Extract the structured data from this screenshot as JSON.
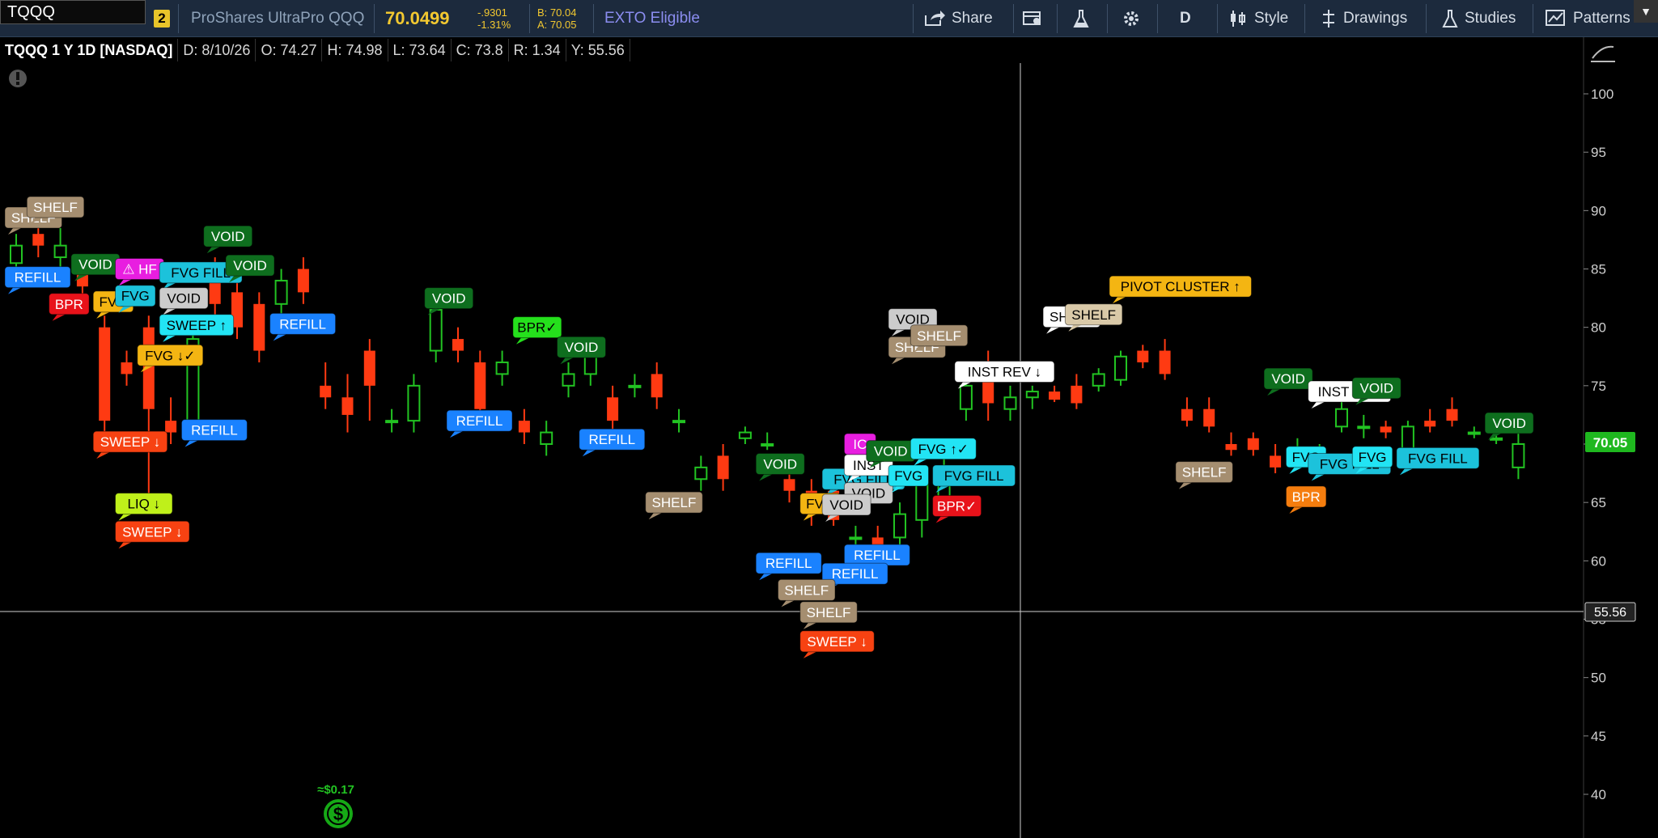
{
  "toolbar": {
    "symbol": "TQQQ",
    "link_number": "2",
    "description": "ProShares UltraPro QQQ",
    "last": "70.0499",
    "change": "-.9301",
    "change_pct": "-1.31%",
    "bid": "B: 70.04",
    "ask": "A: 70.05",
    "exto": "EXTO Eligible",
    "share_label": "Share",
    "aggregation": "D",
    "style_label": "Style",
    "drawings_label": "Drawings",
    "studies_label": "Studies",
    "patterns_label": "Patterns"
  },
  "legend": {
    "title": "TQQQ 1 Y 1D [NASDAQ]",
    "date": "D: 8/10/26",
    "open": "O: 74.27",
    "high": "H: 74.98",
    "low": "L: 73.64",
    "close": "C: 73.8",
    "range": "R: 1.34",
    "y": "Y: 55.56"
  },
  "dividend": {
    "label": "≈$0.17",
    "icon": "dividend-icon"
  },
  "colors": {
    "up": "#22c322",
    "down": "#ff3a12",
    "background": "#000000",
    "price_badge": "#1fb81f"
  },
  "chart_data": {
    "type": "candlestick",
    "y_axis": {
      "min": 40,
      "max": 100,
      "ticks": [
        100,
        95,
        90,
        85,
        80,
        75,
        70,
        65,
        60,
        55,
        50,
        45,
        40
      ]
    },
    "last_price_label": "70.05",
    "crosshair_price_label": "55.56",
    "candles": [
      {
        "open": 85.5,
        "close": 87.0,
        "high": 88.0,
        "low": 84.5
      },
      {
        "open": 88.0,
        "close": 87.0,
        "high": 89.0,
        "low": 86.0
      },
      {
        "open": 86.0,
        "close": 87.0,
        "high": 88.5,
        "low": 85.0
      },
      {
        "open": 85.5,
        "close": 83.5,
        "high": 86.0,
        "low": 82.0
      },
      {
        "open": 80.0,
        "close": 72.0,
        "high": 81.0,
        "low": 71.0
      },
      {
        "open": 77.0,
        "close": 76.0,
        "high": 78.0,
        "low": 75.0
      },
      {
        "open": 80.0,
        "close": 73.0,
        "high": 81.0,
        "low": 65.0
      },
      {
        "open": 72.0,
        "close": 71.0,
        "high": 74.0,
        "low": 70.0
      },
      {
        "open": 72.0,
        "close": 79.0,
        "high": 80.0,
        "low": 71.0
      },
      {
        "open": 84.5,
        "close": 82.0,
        "high": 86.0,
        "low": 81.0
      },
      {
        "open": 83.0,
        "close": 80.0,
        "high": 84.0,
        "low": 79.0
      },
      {
        "open": 82.0,
        "close": 78.0,
        "high": 83.0,
        "low": 77.0
      },
      {
        "open": 82.0,
        "close": 84.0,
        "high": 85.0,
        "low": 81.0
      },
      {
        "open": 85.0,
        "close": 83.0,
        "high": 86.0,
        "low": 82.0
      },
      {
        "open": 75.0,
        "close": 74.0,
        "high": 77.0,
        "low": 73.0
      },
      {
        "open": 74.0,
        "close": 72.5,
        "high": 76.0,
        "low": 71.0
      },
      {
        "open": 78.0,
        "close": 75.0,
        "high": 79.0,
        "low": 72.0
      },
      {
        "open": 72.0,
        "close": 72.0,
        "high": 73.0,
        "low": 71.0
      },
      {
        "open": 72.0,
        "close": 75.0,
        "high": 76.0,
        "low": 71.0
      },
      {
        "open": 78.0,
        "close": 81.5,
        "high": 82.0,
        "low": 77.0
      },
      {
        "open": 79.0,
        "close": 78.0,
        "high": 80.0,
        "low": 77.0
      },
      {
        "open": 77.0,
        "close": 73.0,
        "high": 78.0,
        "low": 72.0
      },
      {
        "open": 76.0,
        "close": 77.0,
        "high": 78.0,
        "low": 75.0
      },
      {
        "open": 72.0,
        "close": 71.0,
        "high": 73.0,
        "low": 70.0
      },
      {
        "open": 70.0,
        "close": 71.0,
        "high": 72.0,
        "low": 69.0
      },
      {
        "open": 75.0,
        "close": 76.0,
        "high": 77.0,
        "low": 74.0
      },
      {
        "open": 76.0,
        "close": 77.5,
        "high": 78.0,
        "low": 75.0
      },
      {
        "open": 74.0,
        "close": 72.0,
        "high": 75.0,
        "low": 71.0
      },
      {
        "open": 75.0,
        "close": 75.0,
        "high": 76.0,
        "low": 74.0
      },
      {
        "open": 76.0,
        "close": 74.0,
        "high": 77.0,
        "low": 73.0
      },
      {
        "open": 72.0,
        "close": 72.0,
        "high": 73.0,
        "low": 71.0
      },
      {
        "open": 67.0,
        "close": 68.0,
        "high": 69.0,
        "low": 66.0
      },
      {
        "open": 69.0,
        "close": 67.0,
        "high": 70.0,
        "low": 66.0
      },
      {
        "open": 70.5,
        "close": 71.0,
        "high": 71.5,
        "low": 70.0
      },
      {
        "open": 70.0,
        "close": 70.0,
        "high": 71.0,
        "low": 69.5
      },
      {
        "open": 67.0,
        "close": 66.0,
        "high": 68.0,
        "low": 65.0
      },
      {
        "open": 66.0,
        "close": 64.0,
        "high": 67.0,
        "low": 63.0
      },
      {
        "open": 66.0,
        "close": 63.5,
        "high": 67.0,
        "low": 63.0
      },
      {
        "open": 62.0,
        "close": 62.0,
        "high": 63.0,
        "low": 61.0
      },
      {
        "open": 62.0,
        "close": 61.0,
        "high": 63.0,
        "low": 60.0
      },
      {
        "open": 62.0,
        "close": 64.0,
        "high": 65.0,
        "low": 61.0
      },
      {
        "open": 63.5,
        "close": 67.0,
        "high": 68.0,
        "low": 62.0
      },
      {
        "open": 65.0,
        "close": 67.0,
        "high": 69.0,
        "low": 64.0
      },
      {
        "open": 73.0,
        "close": 75.0,
        "high": 76.0,
        "low": 72.0
      },
      {
        "open": 76.5,
        "close": 73.5,
        "high": 78.0,
        "low": 72.0
      },
      {
        "open": 73.0,
        "close": 74.0,
        "high": 75.0,
        "low": 72.0
      },
      {
        "open": 74.0,
        "close": 74.5,
        "high": 75.0,
        "low": 73.0
      },
      {
        "open": 74.5,
        "close": 73.8,
        "high": 75.0,
        "low": 73.6
      },
      {
        "open": 75.0,
        "close": 73.5,
        "high": 76.0,
        "low": 73.0
      },
      {
        "open": 75.0,
        "close": 76.0,
        "high": 76.5,
        "low": 74.5
      },
      {
        "open": 75.5,
        "close": 77.5,
        "high": 78.0,
        "low": 75.0
      },
      {
        "open": 78.0,
        "close": 77.0,
        "high": 78.5,
        "low": 76.5
      },
      {
        "open": 78.0,
        "close": 76.0,
        "high": 79.0,
        "low": 75.5
      },
      {
        "open": 73.0,
        "close": 72.0,
        "high": 74.0,
        "low": 71.5
      },
      {
        "open": 73.0,
        "close": 71.5,
        "high": 74.0,
        "low": 71.0
      },
      {
        "open": 70.0,
        "close": 69.5,
        "high": 71.0,
        "low": 69.0
      },
      {
        "open": 70.5,
        "close": 69.5,
        "high": 71.0,
        "low": 69.0
      },
      {
        "open": 69.0,
        "close": 68.0,
        "high": 70.0,
        "low": 67.5
      },
      {
        "open": 69.0,
        "close": 69.5,
        "high": 70.5,
        "low": 68.0
      },
      {
        "open": 68.5,
        "close": 69.5,
        "high": 70.0,
        "low": 68.0
      },
      {
        "open": 71.5,
        "close": 73.0,
        "high": 74.0,
        "low": 71.0
      },
      {
        "open": 71.5,
        "close": 71.5,
        "high": 72.5,
        "low": 70.5
      },
      {
        "open": 71.5,
        "close": 71.0,
        "high": 72.0,
        "low": 70.5
      },
      {
        "open": 69.5,
        "close": 71.5,
        "high": 72.0,
        "low": 69.0
      },
      {
        "open": 72.0,
        "close": 71.5,
        "high": 73.0,
        "low": 71.0
      },
      {
        "open": 73.0,
        "close": 72.0,
        "high": 74.0,
        "low": 71.5
      },
      {
        "open": 71.0,
        "close": 71.0,
        "high": 71.5,
        "low": 70.5
      },
      {
        "open": 70.5,
        "close": 70.5,
        "high": 71.0,
        "low": 70.0
      },
      {
        "open": 68.0,
        "close": 70.0,
        "high": 71.0,
        "low": 67.0
      }
    ],
    "annotations": [
      {
        "text": "SHELF",
        "price": 89.4,
        "bar": 0,
        "color": "#a58e70"
      },
      {
        "text": "SHELF",
        "price": 90.3,
        "bar": 1,
        "color": "#a58e70"
      },
      {
        "text": "REFILL",
        "price": 84.3,
        "bar": 0,
        "color": "#1a82ff"
      },
      {
        "text": "VOID",
        "price": 85.4,
        "bar": 3,
        "color": "#0e6e1e"
      },
      {
        "text": "⚠ HF",
        "price": 85.0,
        "bar": 5,
        "color": "#e81ee0"
      },
      {
        "text": "FVG FILL",
        "price": 84.7,
        "bar": 7,
        "color": "#1cc2db"
      },
      {
        "text": "BPR",
        "price": 82.0,
        "bar": 2,
        "color": "#e8121a"
      },
      {
        "text": "FVG",
        "price": 82.2,
        "bar": 4,
        "color": "#f4b512"
      },
      {
        "text": "FVG",
        "price": 82.7,
        "bar": 5,
        "color": "#1cc2db"
      },
      {
        "text": "VOID",
        "price": 82.5,
        "bar": 7,
        "color": "#cccccc"
      },
      {
        "text": "VOID",
        "price": 87.8,
        "bar": 9,
        "color": "#0e6e1e"
      },
      {
        "text": "VOID",
        "price": 85.3,
        "bar": 10,
        "color": "#0e6e1e"
      },
      {
        "text": "SWEEP ↑",
        "price": 80.2,
        "bar": 7,
        "color": "#22e4f4"
      },
      {
        "text": "FVG ↓✓",
        "price": 77.6,
        "bar": 6,
        "color": "#f4b512"
      },
      {
        "text": "REFILL",
        "price": 80.3,
        "bar": 12,
        "color": "#1a82ff"
      },
      {
        "text": "SWEEP ↓",
        "price": 70.2,
        "bar": 4,
        "color": "#f74212"
      },
      {
        "text": "REFILL",
        "price": 71.2,
        "bar": 8,
        "color": "#1a82ff"
      },
      {
        "text": "LIQ ↓",
        "price": 64.9,
        "bar": 5,
        "color": "#bff01a"
      },
      {
        "text": "SWEEP ↓",
        "price": 62.5,
        "bar": 5,
        "color": "#f74212"
      },
      {
        "text": "VOID",
        "price": 82.5,
        "bar": 19,
        "color": "#0e6e1e"
      },
      {
        "text": "REFILL",
        "price": 72.0,
        "bar": 20,
        "color": "#1a82ff"
      },
      {
        "text": "BPR✓",
        "price": 80.0,
        "bar": 23,
        "color": "#25e01c"
      },
      {
        "text": "VOID",
        "price": 78.3,
        "bar": 25,
        "color": "#0e6e1e"
      },
      {
        "text": "REFILL",
        "price": 70.4,
        "bar": 26,
        "color": "#1a82ff"
      },
      {
        "text": "SHELF",
        "price": 65.0,
        "bar": 29,
        "color": "#a58e70"
      },
      {
        "text": "VOID",
        "price": 68.3,
        "bar": 34,
        "color": "#0e6e1e"
      },
      {
        "text": "FVG FILL",
        "price": 67.0,
        "bar": 37,
        "color": "#1cc2db"
      },
      {
        "text": "VOID",
        "price": 65.8,
        "bar": 38,
        "color": "#cccccc"
      },
      {
        "text": "FVG",
        "price": 64.9,
        "bar": 36,
        "color": "#f4b512"
      },
      {
        "text": "VOID",
        "price": 64.8,
        "bar": 37,
        "color": "#cccccc"
      },
      {
        "text": "REFILL",
        "price": 59.8,
        "bar": 34,
        "color": "#1a82ff"
      },
      {
        "text": "REFILL",
        "price": 60.5,
        "bar": 38,
        "color": "#1a82ff"
      },
      {
        "text": "REFILL",
        "price": 58.9,
        "bar": 37,
        "color": "#1a82ff"
      },
      {
        "text": "SHELF",
        "price": 57.5,
        "bar": 35,
        "color": "#a58e70"
      },
      {
        "text": "SHELF",
        "price": 55.6,
        "bar": 36,
        "color": "#a58e70"
      },
      {
        "text": "SWEEP ↓",
        "price": 53.1,
        "bar": 36,
        "color": "#f74212"
      },
      {
        "text": "IC",
        "price": 70.0,
        "bar": 38,
        "color": "#e81ee0"
      },
      {
        "text": "INST",
        "price": 68.2,
        "bar": 38,
        "color": "#ffffff"
      },
      {
        "text": "VOID",
        "price": 69.4,
        "bar": 39,
        "color": "#0e6e1e"
      },
      {
        "text": "FVG",
        "price": 67.3,
        "bar": 40,
        "color": "#22e4f4"
      },
      {
        "text": "FVG ↑✓",
        "price": 69.6,
        "bar": 41,
        "color": "#22e4f4"
      },
      {
        "text": "FVG FILL",
        "price": 67.3,
        "bar": 42,
        "color": "#1cc2db"
      },
      {
        "text": "BPR✓",
        "price": 64.7,
        "bar": 42,
        "color": "#e8121a"
      },
      {
        "text": "VOID",
        "price": 80.7,
        "bar": 40,
        "color": "#cccccc"
      },
      {
        "text": "SHELF",
        "price": 78.3,
        "bar": 40,
        "color": "#a58e70"
      },
      {
        "text": "SHELF",
        "price": 79.3,
        "bar": 41,
        "color": "#a58e70"
      },
      {
        "text": "INST REV ↓",
        "price": 76.2,
        "bar": 43,
        "color": "#ffffff"
      },
      {
        "text": "PIVOT CLUSTER ↑",
        "price": 83.5,
        "bar": 50,
        "color": "#f4b512"
      },
      {
        "text": "SHELF",
        "price": 80.9,
        "bar": 47,
        "color": "#ffffff"
      },
      {
        "text": "SHELF",
        "price": 81.1,
        "bar": 48,
        "color": "#d9c9a8"
      },
      {
        "text": "SHELF",
        "price": 67.6,
        "bar": 53,
        "color": "#a58e70"
      },
      {
        "text": "VOID",
        "price": 75.6,
        "bar": 57,
        "color": "#0e6e1e"
      },
      {
        "text": "INST REV",
        "price": 74.5,
        "bar": 59,
        "color": "#ffffff"
      },
      {
        "text": "VOID",
        "price": 74.8,
        "bar": 61,
        "color": "#0e6e1e"
      },
      {
        "text": "FVG",
        "price": 68.9,
        "bar": 58,
        "color": "#22e4f4"
      },
      {
        "text": "FVG FILL",
        "price": 68.3,
        "bar": 59,
        "color": "#1cc2db"
      },
      {
        "text": "BPR",
        "price": 65.5,
        "bar": 58,
        "color": "#f57d0e"
      },
      {
        "text": "FVG",
        "price": 68.9,
        "bar": 61,
        "color": "#22e4f4"
      },
      {
        "text": "FVG FILL",
        "price": 68.8,
        "bar": 63,
        "color": "#1cc2db"
      },
      {
        "text": "VOID",
        "price": 71.8,
        "bar": 67,
        "color": "#0e6e1e"
      }
    ]
  }
}
